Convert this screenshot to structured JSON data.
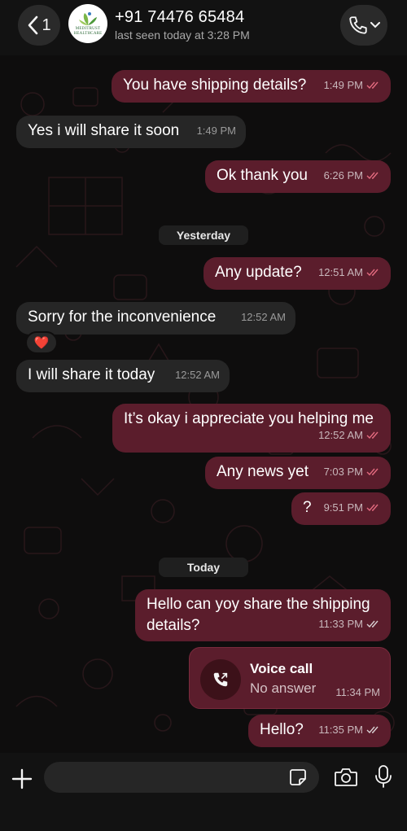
{
  "header": {
    "back_count": "1",
    "avatar_text_line1": "MEDITRUST",
    "avatar_text_line2": "HEALTHCARE",
    "contact_name": "+91 74476 65484",
    "status": "last seen today at 3:28 PM"
  },
  "colors": {
    "outgoing_bubble": "#5b1d2c",
    "incoming_bubble": "#262626",
    "background": "#0e0d0d",
    "read_ticks": "#c9b8bc"
  },
  "messages": [
    {
      "dir": "out",
      "text": "You have shipping details?",
      "time": "1:49 PM",
      "status": "read"
    },
    {
      "dir": "in",
      "text": "Yes i will share it soon",
      "time": "1:49 PM"
    },
    {
      "dir": "out",
      "text": "Ok thank you",
      "time": "6:26 PM",
      "status": "read"
    },
    {
      "type": "date",
      "text": "Yesterday"
    },
    {
      "dir": "out",
      "text": "Any update?",
      "time": "12:51 AM",
      "status": "read"
    },
    {
      "dir": "in",
      "text": "Sorry for the inconvenience",
      "time": "12:52 AM",
      "reaction": "❤️"
    },
    {
      "dir": "in",
      "text": "I will share it today",
      "time": "12:52 AM"
    },
    {
      "dir": "out",
      "text": "It’s okay i appreciate you helping me",
      "time": "12:52 AM",
      "status": "read"
    },
    {
      "dir": "out",
      "text": "Any news yet",
      "time": "7:03 PM",
      "status": "read"
    },
    {
      "dir": "out",
      "text": "?",
      "time": "9:51 PM",
      "status": "read"
    },
    {
      "type": "date",
      "text": "Today"
    },
    {
      "dir": "out",
      "text": "Hello can yoy share the shipping details?",
      "time": "11:33 PM",
      "status": "delivered"
    },
    {
      "type": "call",
      "title": "Voice call",
      "subtitle": "No answer",
      "time": "11:34 PM"
    },
    {
      "dir": "out",
      "text": "Hello?",
      "time": "11:35 PM",
      "status": "delivered"
    }
  ],
  "input": {
    "value": "",
    "icons": [
      "plus-icon",
      "sticker-icon",
      "camera-icon",
      "mic-icon"
    ]
  }
}
